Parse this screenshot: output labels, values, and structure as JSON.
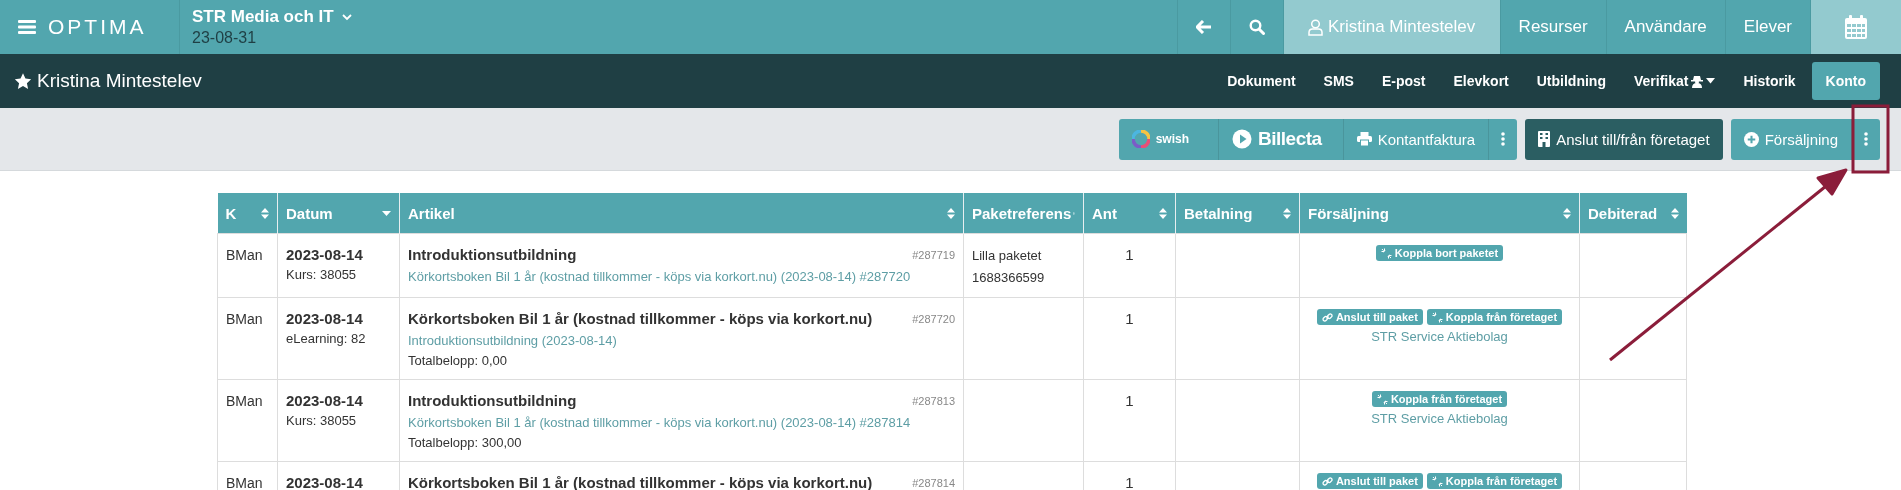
{
  "header": {
    "logo": "OPTIMA",
    "company": "STR Media och IT",
    "date": "23-08-31",
    "nav": [
      {
        "kind": "back",
        "selected": false
      },
      {
        "kind": "search",
        "selected": false
      },
      {
        "kind": "user",
        "label": "Kristina Mintestelev",
        "selected": true
      },
      {
        "kind": "link",
        "label": "Resurser",
        "selected": false
      },
      {
        "kind": "link",
        "label": "Användare",
        "selected": false
      },
      {
        "kind": "link",
        "label": "Elever",
        "selected": false
      },
      {
        "kind": "calendar",
        "selected": true
      }
    ]
  },
  "student": {
    "name": "Kristina Mintestelev",
    "tabs": [
      {
        "label": "Dokument",
        "selected": false
      },
      {
        "label": "SMS",
        "selected": false
      },
      {
        "label": "E-post",
        "selected": false
      },
      {
        "label": "Elevkort",
        "selected": false
      },
      {
        "label": "Utbildning",
        "selected": false
      },
      {
        "label": "Verifikat",
        "kind": "dropdown",
        "selected": false
      },
      {
        "label": "Historik",
        "selected": false
      },
      {
        "label": "Konto",
        "selected": true
      }
    ]
  },
  "toolbar": {
    "payments": [
      {
        "kind": "swish",
        "label": "swish"
      },
      {
        "kind": "billecta",
        "label": "Billecta"
      },
      {
        "kind": "print",
        "label": "Kontantfaktura"
      },
      {
        "kind": "more"
      }
    ],
    "company_button": "Anslut till/från företaget",
    "sale_button": "Försäljning"
  },
  "table": {
    "columns": [
      {
        "label": "K",
        "sorted": false
      },
      {
        "label": "Datum",
        "sorted": true
      },
      {
        "label": "Artikel",
        "sorted": false
      },
      {
        "label": "Paketreferens",
        "sorted": false
      },
      {
        "label": "Ant",
        "sorted": false
      },
      {
        "label": "Betalning",
        "sorted": false
      },
      {
        "label": "Försäljning",
        "sorted": false
      },
      {
        "label": "Debiterad",
        "sorted": false
      }
    ],
    "rows": [
      {
        "k": "BMan",
        "date": "2023-08-14",
        "sub": "Kurs: 38055",
        "title": "Introduktionsutbildning",
        "id": "#287719",
        "link": "Körkortsboken Bil 1 år (kostnad tillkommer - köps via korkort.nu) (2023-08-14) #287720",
        "package": [
          "Lilla paketet",
          "1688366599"
        ],
        "ant": "1",
        "actions": [
          {
            "kind": "unlink",
            "label": "Koppla bort paketet"
          }
        ]
      },
      {
        "k": "BMan",
        "date": "2023-08-14",
        "sub": "eLearning: 82",
        "title": "Körkortsboken Bil 1 år (kostnad tillkommer - köps via korkort.nu)",
        "id": "#287720",
        "link": "Introduktionsutbildning (2023-08-14)",
        "total": "Totalbelopp: 0,00",
        "ant": "1",
        "actions": [
          {
            "kind": "link",
            "label": "Anslut till paket"
          },
          {
            "kind": "unlink",
            "label": "Koppla från företaget"
          }
        ],
        "company": "STR Service Aktiebolag"
      },
      {
        "k": "BMan",
        "date": "2023-08-14",
        "sub": "Kurs: 38055",
        "title": "Introduktionsutbildning",
        "id": "#287813",
        "link": "Körkortsboken Bil 1 år (kostnad tillkommer - köps via korkort.nu) (2023-08-14) #287814",
        "total": "Totalbelopp: 300,00",
        "ant": "1",
        "actions": [
          {
            "kind": "unlink",
            "label": "Koppla från företaget"
          }
        ],
        "company": "STR Service Aktiebolag"
      },
      {
        "k": "BMan",
        "date": "2023-08-14",
        "title": "Körkortsboken Bil 1 år (kostnad tillkommer - köps via korkort.nu)",
        "id": "#287814",
        "ant": "1",
        "actions": [
          {
            "kind": "link",
            "label": "Anslut till paket"
          },
          {
            "kind": "unlink",
            "label": "Koppla från företaget"
          }
        ]
      }
    ]
  }
}
